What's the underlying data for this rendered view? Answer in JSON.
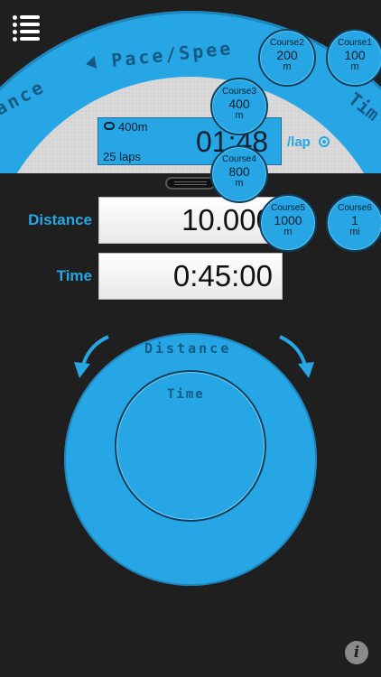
{
  "arc": {
    "pace_label": "Pace/Spee",
    "left_label": "ance",
    "right_label": "Tim"
  },
  "lap_panel": {
    "track": "400m",
    "laps": "25 laps",
    "time": "01:48",
    "per_lap": "/lap"
  },
  "rows": {
    "distance_label": "Distance",
    "distance_value": "10.000",
    "time_label": "Time",
    "time_value": "0:45:00"
  },
  "courses": [
    {
      "name": "Course1",
      "value": "100",
      "unit": "m"
    },
    {
      "name": "Course2",
      "value": "200",
      "unit": "m"
    },
    {
      "name": "Course3",
      "value": "400",
      "unit": "m"
    },
    {
      "name": "Course4",
      "value": "800",
      "unit": "m"
    },
    {
      "name": "Course5",
      "value": "1000",
      "unit": "m"
    },
    {
      "name": "Course6",
      "value": "1",
      "unit": "mi"
    }
  ],
  "dial": {
    "outer_label": "Distance",
    "inner_label": "Time"
  },
  "info": "i",
  "colors": {
    "accent": "#27a6e6",
    "background": "#1f1f1f",
    "dark_text": "#0b1f2d"
  }
}
